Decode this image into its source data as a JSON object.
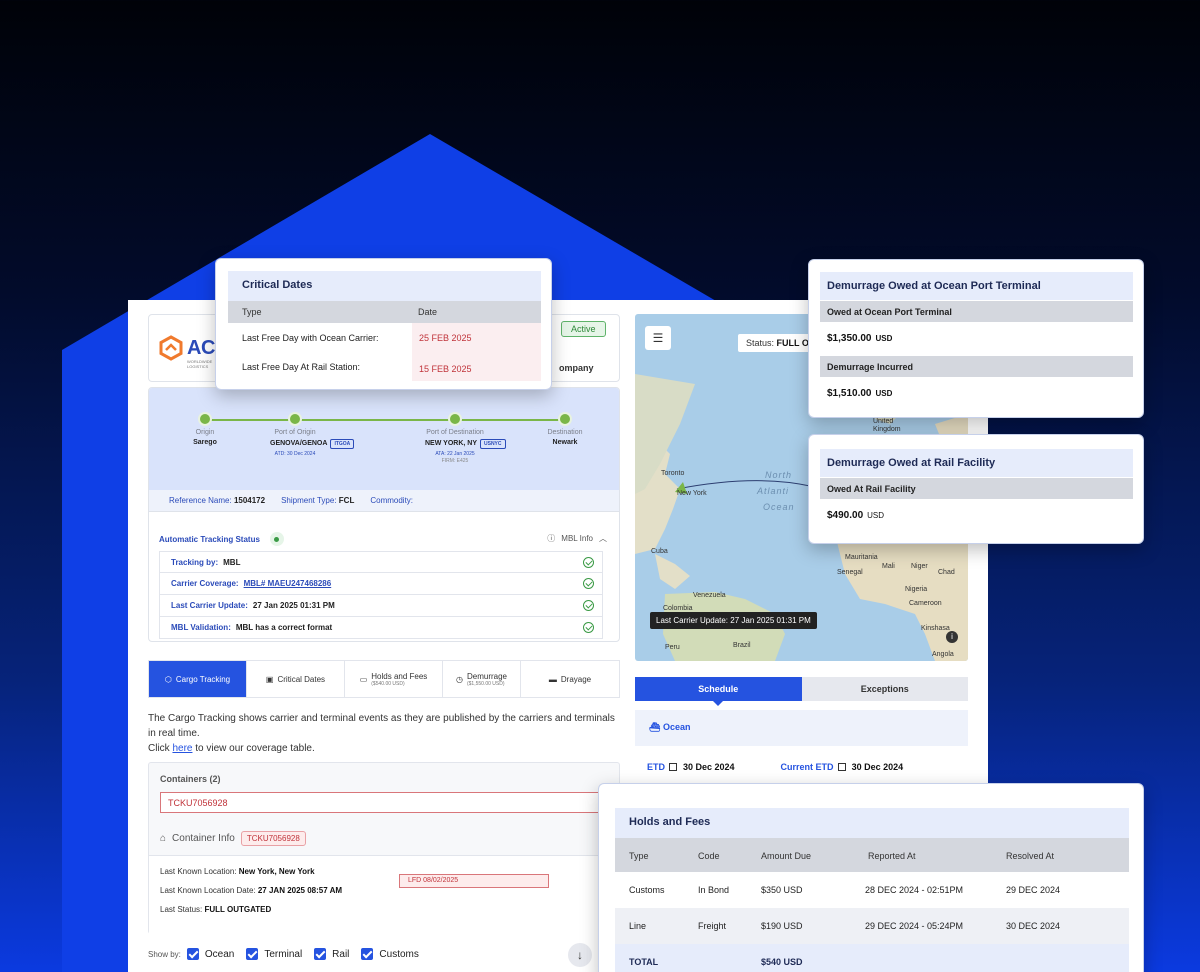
{
  "company": {
    "logo_text": "ACM",
    "logo_sub": "WORLDWIDE LOGISTICS",
    "status_badge": "Active",
    "company_label": "ompany"
  },
  "route": {
    "stops": [
      {
        "label": "Origin",
        "value": "Sarego"
      },
      {
        "label": "Port of Origin",
        "value": "GENOVA/GENOA",
        "code": "ITGOA",
        "sub": "ATD: 30 Dec 2024"
      },
      {
        "label": "Port of Destination",
        "value": "NEW YORK, NY",
        "code": "USNYC",
        "sub": "ATA: 22 Jan 2025",
        "sub2": "FIRM: E425"
      },
      {
        "label": "Destination",
        "value": "Newark"
      }
    ],
    "reference_label": "Reference Name:",
    "reference_value": "1504172",
    "shipment_type_label": "Shipment Type:",
    "shipment_type_value": "FCL",
    "commodity_label": "Commodity:"
  },
  "tracking_status": {
    "title": "Automatic Tracking Status",
    "mbl_info": "MBL Info",
    "rows": [
      {
        "label": "Tracking by:",
        "value": "MBL"
      },
      {
        "label": "Carrier Coverage:",
        "value": "MBL# MAEU247468286"
      },
      {
        "label": "Last Carrier Update:",
        "value": "27 Jan 2025 01:31 PM"
      },
      {
        "label": "MBL Validation:",
        "value": "MBL has a correct format"
      }
    ]
  },
  "tabs": [
    {
      "label": "Cargo Tracking"
    },
    {
      "label": "Critical Dates"
    },
    {
      "label": "Holds and Fees",
      "sub": "($540.00 USD)"
    },
    {
      "label": "Demurrage",
      "sub": "($1,550.00 USD)"
    },
    {
      "label": "Drayage"
    }
  ],
  "description": {
    "text": "The Cargo Tracking shows carrier and terminal events as they are published by the carriers and terminals in real time.",
    "click_prefix": "Click",
    "link": "here",
    "click_suffix": "to view our coverage table."
  },
  "containers": {
    "header": "Containers (2)",
    "selected": "TCKU7056928",
    "info_label": "Container Info",
    "info_chip": "TCKU7056928",
    "location_label": "Last Known Location:",
    "location_value": "New York, New York",
    "date_label": "Last Known Location Date:",
    "date_value": "27 JAN 2025 08:57 AM",
    "status_label": "Last Status:",
    "status_value": "FULL OUTGATED",
    "lfd": "LFD  08/02/2025"
  },
  "show_by": {
    "label": "Show by:",
    "options": [
      "Ocean",
      "Terminal",
      "Rail",
      "Customs"
    ]
  },
  "map": {
    "status_label": "Status:",
    "status_value": "FULL O",
    "tooltip": "Last Carrier Update: 27 Jan 2025 01:31 PM",
    "labels": {
      "toronto": "Toronto",
      "new_york": "New York",
      "cuba": "Cuba",
      "venezuela": "Venezuela",
      "colombia": "Colombia",
      "peru": "Peru",
      "brazil": "Brazil",
      "united_kingdom": "United Kingdom",
      "mauritania": "Mauritania",
      "mali": "Mali",
      "niger": "Niger",
      "senegal": "Senegal",
      "chad": "Chad",
      "nigeria": "Nigeria",
      "cameroon": "Cameroon",
      "kinshasa": "Kinshasa",
      "angola": "Angola",
      "ocean_1": "North",
      "ocean_2": "Atlanti",
      "ocean_3": "Ocean"
    }
  },
  "schedule": {
    "tab_schedule": "Schedule",
    "tab_exceptions": "Exceptions",
    "mode": "Ocean",
    "etd_label": "ETD",
    "etd_value": "30 Dec 2024",
    "current_etd_label": "Current ETD",
    "current_etd_value": "30 Dec 2024"
  },
  "critical_dates": {
    "title": "Critical Dates",
    "col_type": "Type",
    "col_date": "Date",
    "rows": [
      {
        "type": "Last Free Day with Ocean Carrier:",
        "date": "25 FEB 2025"
      },
      {
        "type": "Last Free Day At Rail Station:",
        "date": "15 FEB 2025"
      }
    ]
  },
  "demurrage_port": {
    "title": "Demurrage Owed at Ocean Port Terminal",
    "owed_label": "Owed at Ocean Port Terminal",
    "owed_amount": "$1,350.00",
    "owed_currency": "USD",
    "incurred_label": "Demurrage Incurred",
    "incurred_amount": "$1,510.00",
    "incurred_currency": "USD"
  },
  "demurrage_rail": {
    "title": "Demurrage Owed at Rail Facility",
    "owed_label": "Owed At Rail Facility",
    "owed_amount": "$490.00",
    "owed_currency": "USD"
  },
  "holds_fees": {
    "title": "Holds and Fees",
    "columns": [
      "Type",
      "Code",
      "Amount Due",
      "Reported At",
      "Resolved At"
    ],
    "rows": [
      {
        "type": "Customs",
        "code": "In Bond",
        "amount": "$350 USD",
        "reported": "28 DEC 2024 - 02:51PM",
        "resolved": "29 DEC 2024"
      },
      {
        "type": "Line",
        "code": "Freight",
        "amount": "$190 USD",
        "reported": "29 DEC 2024 - 05:24PM",
        "resolved": "30 DEC 2024"
      }
    ],
    "total_label": "TOTAL",
    "total_amount": "$540 USD"
  },
  "colors": {
    "accent": "#2553e0",
    "status_green": "#7ab648",
    "alert_red": "#c0333a"
  }
}
